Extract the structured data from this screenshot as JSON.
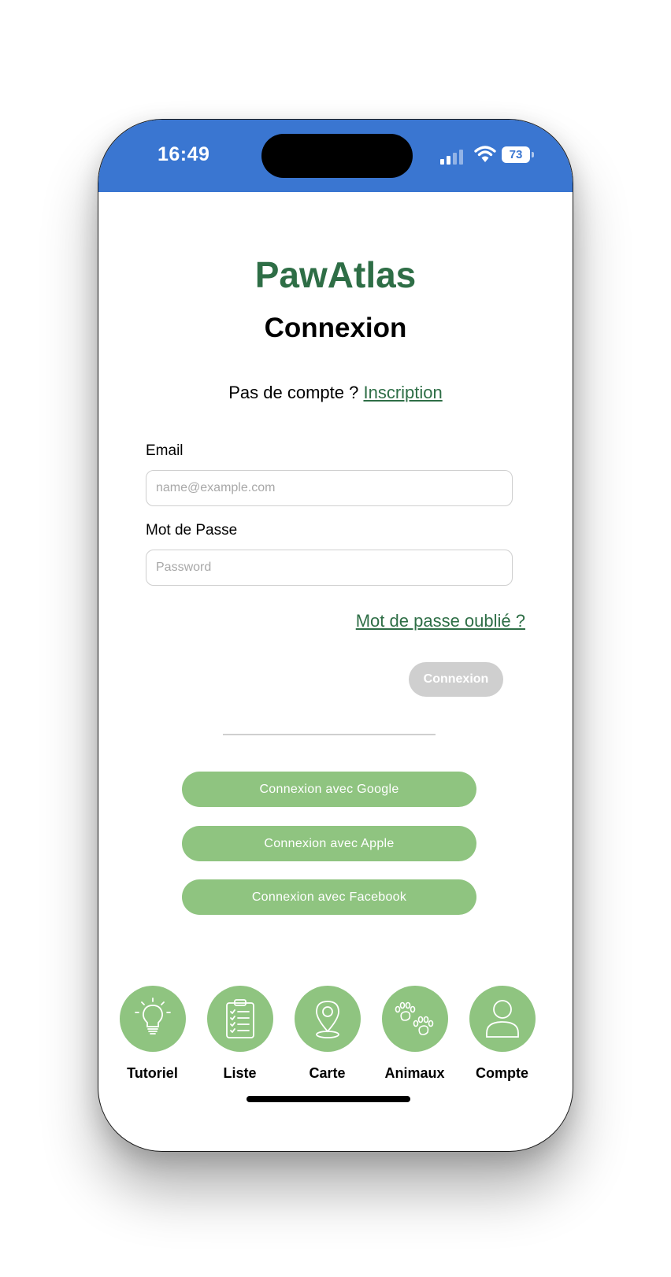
{
  "status": {
    "time": "16:49",
    "battery": "73"
  },
  "app": {
    "name": "PawAtlas"
  },
  "page": {
    "title": "Connexion",
    "signup_prompt": "Pas de compte ?",
    "signup_link": "Inscription"
  },
  "form": {
    "email_label": "Email",
    "email_placeholder": "name@example.com",
    "password_label": "Mot de Passe",
    "password_placeholder": "Password",
    "forgot_link": "Mot de passe oublié ?",
    "submit_label": "Connexion"
  },
  "social": {
    "google": "Connexion avec Google",
    "apple": "Connexion avec Apple",
    "facebook": "Connexion avec Facebook"
  },
  "tabs": [
    {
      "label": "Tutoriel",
      "icon": "lightbulb-icon"
    },
    {
      "label": "Liste",
      "icon": "clipboard-list-icon"
    },
    {
      "label": "Carte",
      "icon": "map-pin-icon"
    },
    {
      "label": "Animaux",
      "icon": "paw-prints-icon"
    },
    {
      "label": "Compte",
      "icon": "user-icon"
    }
  ],
  "colors": {
    "status_bar": "#3a76d1",
    "brand_green": "#2e6e46",
    "button_green": "#8fc480",
    "disabled_gray": "#cfcfcf"
  }
}
